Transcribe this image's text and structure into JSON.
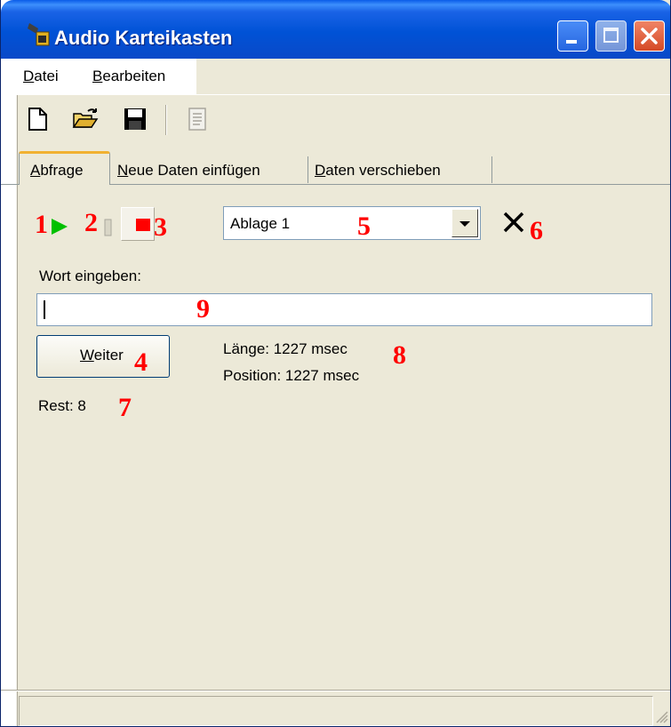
{
  "window": {
    "title": "Audio Karteikasten"
  },
  "menu": [
    {
      "label": "Datei",
      "accel": "D",
      "rest": "atei"
    },
    {
      "label": "Bearbeiten",
      "accel": "B",
      "rest": "earbeiten"
    }
  ],
  "toolbar": {
    "icons": [
      "new-document-icon",
      "open-folder-icon",
      "save-floppy-icon",
      "disabled-document-icon"
    ]
  },
  "tabs": [
    {
      "label": "Abfrage",
      "accel": "A",
      "rest": "bfrage",
      "selected": true
    },
    {
      "label": "Neue Daten einfügen",
      "accel": "N",
      "rest": "eue Daten einfügen",
      "selected": false
    },
    {
      "label": "Daten verschieben",
      "accel": "D",
      "rest": "aten verschieben",
      "selected": false
    }
  ],
  "controls": {
    "combo_value": "Ablage 1",
    "word_label": "Wort eingeben:",
    "word_value": "",
    "weiter_accel": "W",
    "weiter_rest": "eiter",
    "length_text": "Länge: 1227 msec",
    "position_text": "Position: 1227 msec",
    "rest_text": "Rest: 8"
  },
  "annotations": [
    "1",
    "2",
    "3",
    "4",
    "5",
    "6",
    "7",
    "8",
    "9"
  ],
  "colors": {
    "title_blue": "#0a5ce8",
    "annotation_red": "#ff0000",
    "play_green": "#00c000",
    "stop_red": "#ff0000",
    "face": "#ece9d8"
  }
}
